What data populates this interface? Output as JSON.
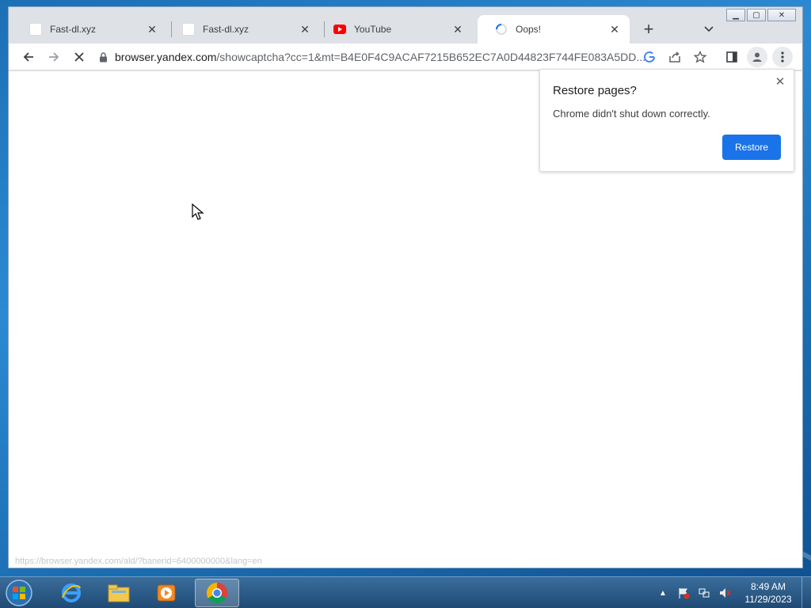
{
  "browser": {
    "tabs": [
      {
        "title": "Fast-dl.xyz",
        "favicon": "blank-page-icon",
        "active": false
      },
      {
        "title": "Fast-dl.xyz",
        "favicon": "blank-page-icon",
        "active": false
      },
      {
        "title": "YouTube",
        "favicon": "youtube-icon",
        "active": false
      },
      {
        "title": "Oops!",
        "favicon": "loading-spinner-icon",
        "active": true
      }
    ],
    "new_tab_icon": "plus-icon",
    "tab_search_icon": "chevron-down-icon",
    "address_bar": {
      "host": "browser.yandex.com",
      "path": "/showcaptcha?cc=1&mt=B4E0F4C9ACAF7215B652EC7A0D44823F744FE083A5DD..."
    },
    "status_url": "https://browser.yandex.com/ald/?banerid=6400000000&lang=en"
  },
  "restore_bubble": {
    "title": "Restore pages?",
    "message": "Chrome didn't shut down correctly.",
    "restore_label": "Restore"
  },
  "taskbar": {
    "apps": [
      "internet-explorer-icon",
      "file-explorer-icon",
      "media-player-icon",
      "chrome-icon"
    ],
    "clock_time": "8:49 AM",
    "clock_date": "11/29/2023"
  },
  "colors": {
    "accent": "#1a73e8",
    "youtube_red": "#ff0000",
    "tab_strip": "#dee1e6"
  }
}
